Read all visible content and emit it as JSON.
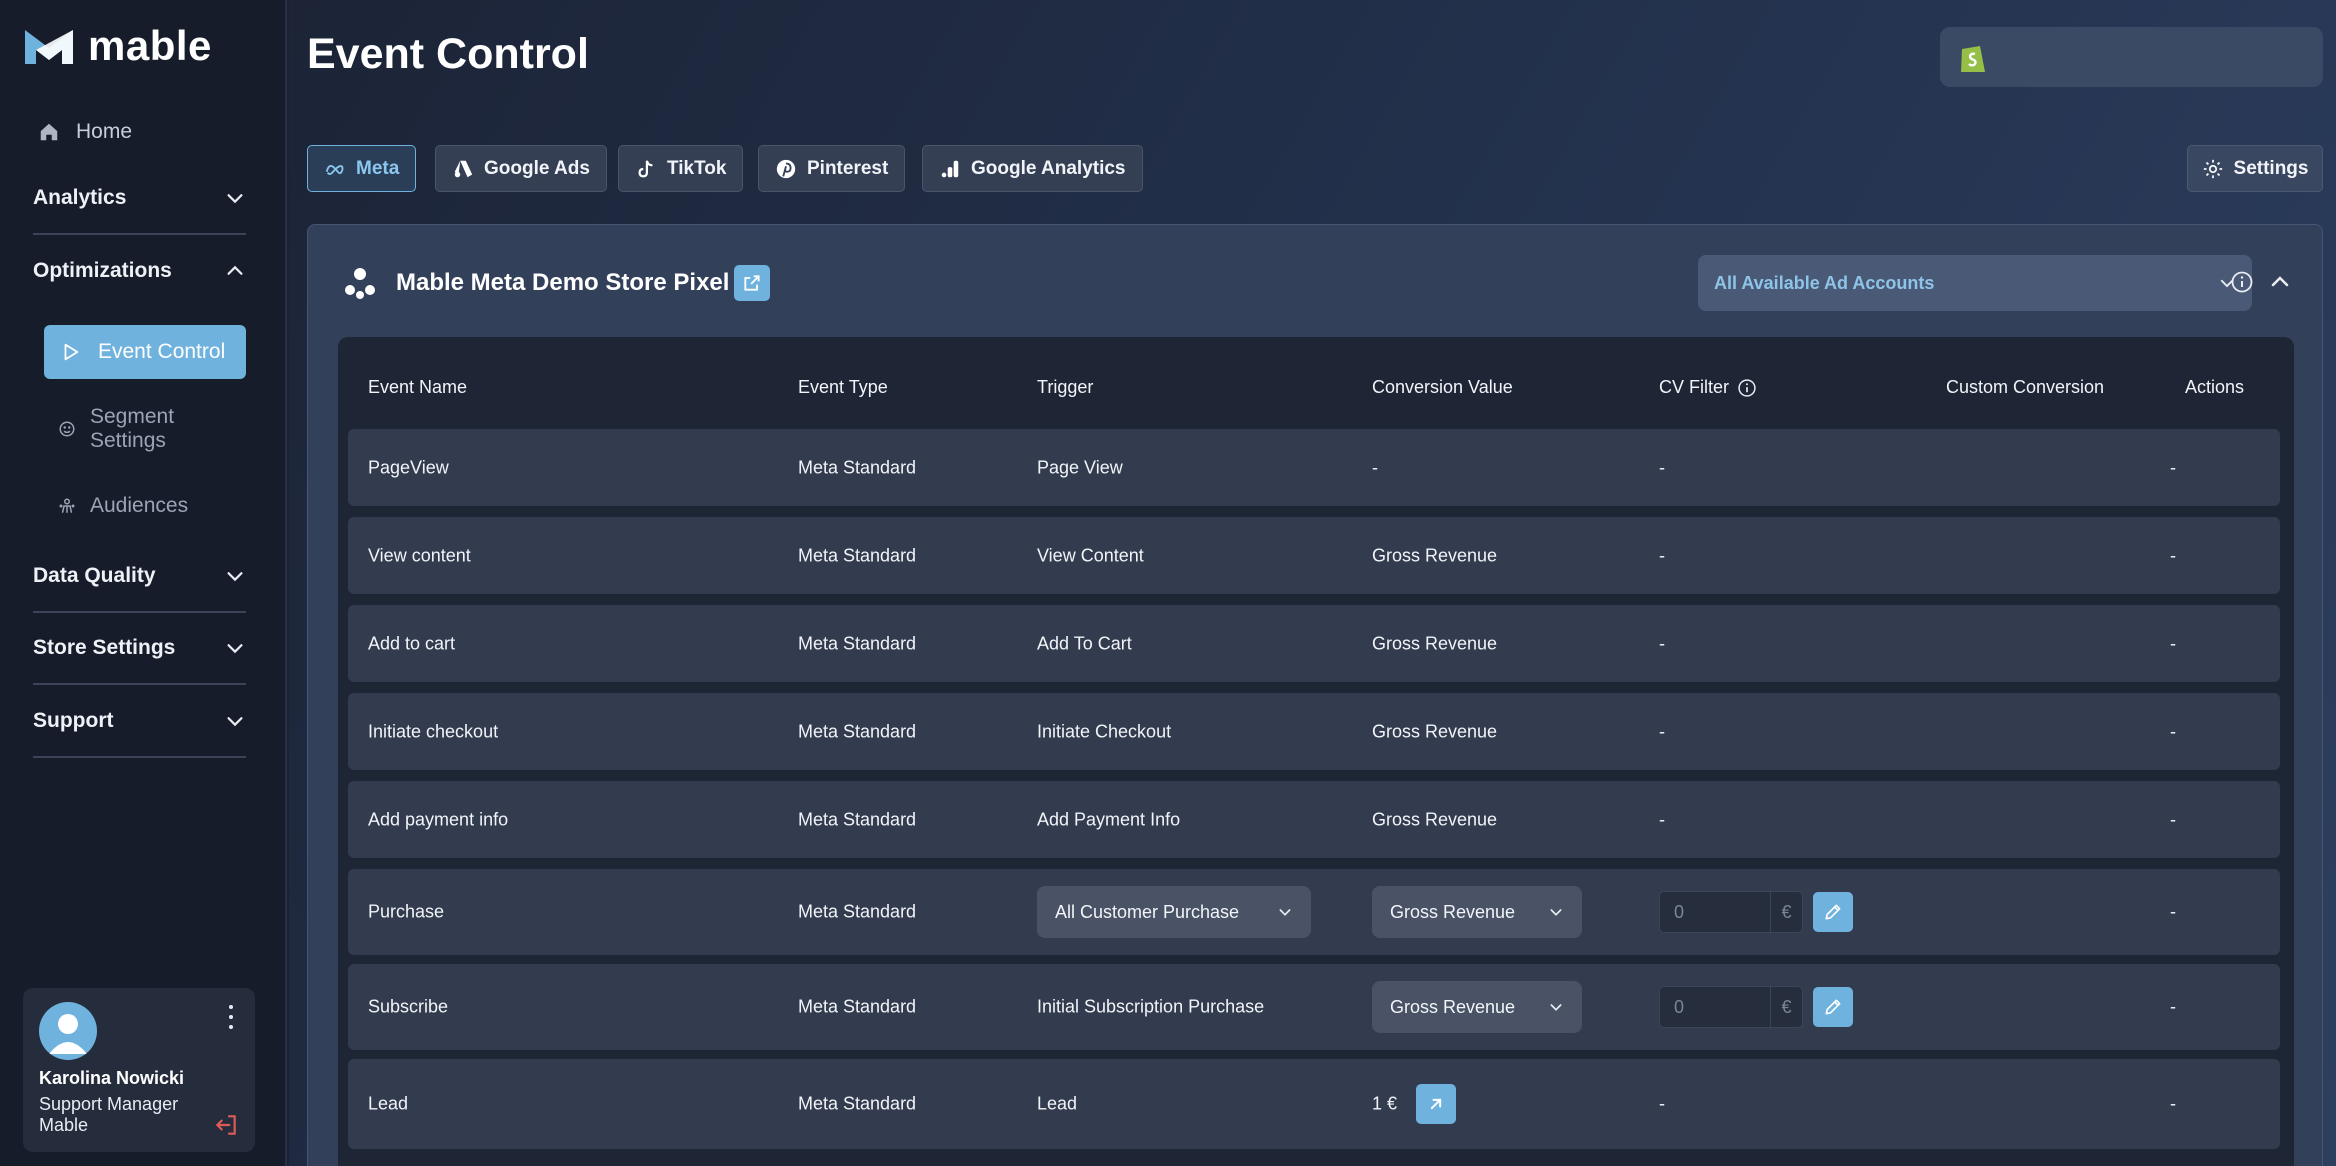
{
  "brand": {
    "name": "mable"
  },
  "sidebar": {
    "home": "Home",
    "sections": {
      "analytics": "Analytics",
      "optimizations": "Optimizations",
      "data_quality": "Data Quality",
      "store_settings": "Store Settings",
      "support": "Support"
    },
    "optimizations_items": {
      "event_control": "Event Control",
      "segment_settings": "Segment Settings",
      "audiences": "Audiences"
    },
    "user": {
      "name": "Karolina Nowicki",
      "role": "Support Manager",
      "company": "Mable"
    }
  },
  "header": {
    "title": "Event Control"
  },
  "platform_tabs": {
    "meta": "Meta",
    "google_ads": "Google Ads",
    "tiktok": "TikTok",
    "pinterest": "Pinterest",
    "google_analytics": "Google Analytics",
    "active": "Meta"
  },
  "settings_label": "Settings",
  "pixel": {
    "name": "Mable Meta Demo Store Pixel",
    "ad_account_select": "All Available Ad Accounts"
  },
  "table": {
    "columns": {
      "event_name": "Event Name",
      "event_type": "Event Type",
      "trigger": "Trigger",
      "conversion_value": "Conversion Value",
      "cv_filter": "CV Filter",
      "custom_conversion": "Custom Conversion",
      "actions": "Actions"
    },
    "rows": [
      {
        "event_name": "PageView",
        "event_type": "Meta Standard",
        "trigger": "Page View",
        "conversion_value": "-",
        "cv_filter": "-",
        "custom_conversion": "-"
      },
      {
        "event_name": "View content",
        "event_type": "Meta Standard",
        "trigger": "View Content",
        "conversion_value": "Gross Revenue",
        "cv_filter": "-",
        "custom_conversion": "-"
      },
      {
        "event_name": "Add to cart",
        "event_type": "Meta Standard",
        "trigger": "Add To Cart",
        "conversion_value": "Gross Revenue",
        "cv_filter": "-",
        "custom_conversion": "-"
      },
      {
        "event_name": "Initiate checkout",
        "event_type": "Meta Standard",
        "trigger": "Initiate Checkout",
        "conversion_value": "Gross Revenue",
        "cv_filter": "-",
        "custom_conversion": "-"
      },
      {
        "event_name": "Add payment info",
        "event_type": "Meta Standard",
        "trigger": "Add Payment Info",
        "conversion_value": "Gross Revenue",
        "cv_filter": "-",
        "custom_conversion": "-"
      },
      {
        "event_name": "Purchase",
        "event_type": "Meta Standard",
        "trigger": "All Customer Purchase",
        "conversion_value": "Gross Revenue",
        "cv_filter_value": "0",
        "cv_filter_currency": "€",
        "custom_conversion": "-"
      },
      {
        "event_name": "Subscribe",
        "event_type": "Meta Standard",
        "trigger": "Initial Subscription Purchase",
        "conversion_value": "Gross Revenue",
        "cv_filter_value": "0",
        "cv_filter_currency": "€",
        "custom_conversion": "-"
      },
      {
        "event_name": "Lead",
        "event_type": "Meta Standard",
        "trigger": "Lead",
        "conversion_value": "1 €",
        "cv_filter": "-",
        "custom_conversion": "-"
      }
    ]
  },
  "colors": {
    "accent": "#6fb2de",
    "sidebar_bg": "#161c2a",
    "table_bg": "#1e2535",
    "row_bg": "#333c4e",
    "logout_red": "#e05a5a",
    "shopify_green": "#95bf47"
  },
  "icons": {
    "home": "home-icon",
    "chevron": "chevron-down-icon",
    "event_control": "play-outline-icon",
    "segment_settings": "segment-icon",
    "audiences": "audiences-icon",
    "logout": "logout-icon",
    "shopify": "shopify-icon",
    "settings": "gear-icon",
    "pixel": "pixel-icon",
    "external": "external-link-icon",
    "edit": "pencil-icon"
  }
}
